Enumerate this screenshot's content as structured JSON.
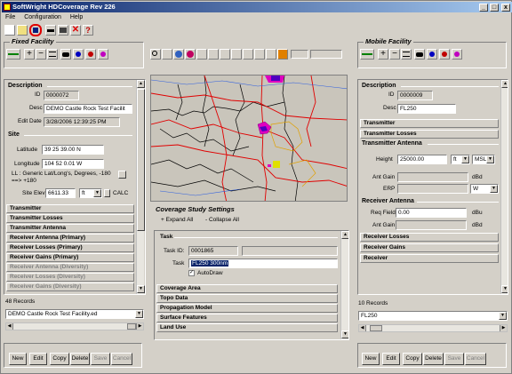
{
  "window": {
    "title": "SoftWright HDCoverage Rev 226",
    "min": "_",
    "max": "□",
    "close": "x"
  },
  "menu": [
    "File",
    "Configuration",
    "Help"
  ],
  "fixed": {
    "group_title": "Fixed Facility",
    "description": {
      "header": "Description",
      "id_label": "ID",
      "id": "0000072",
      "desc_label": "Desc",
      "desc": "DEMO Castle Rock Test Facilit",
      "edit_label": "Edit Date",
      "edit": "3/28/2006 12:39:25 PM"
    },
    "site": {
      "header": "Site",
      "lat_label": "Latitude",
      "lat": "39 25 39.00 N",
      "lon_label": "Longitude",
      "lon": "104 52 0.01 W",
      "ll_note": "LL : Generic Lat/Long's, Degrees, -180 ==> +180",
      "elev_label": "Site Elev",
      "elev": "6611.33",
      "unit": "ft",
      "calc": "CALC"
    },
    "sections": [
      "Transmitter",
      "Transmitter Losses",
      "Transmitter Antenna",
      "Receiver Antenna (Primary)",
      "Receiver Losses (Primary)",
      "Receiver Gains (Primary)",
      "Receiver Antenna (Diversity)",
      "Receiver Losses (Diversity)",
      "Receiver Gains (Diversity)"
    ],
    "records": "48 Records",
    "selected": "DEMO Castle Rock Test Facility.ed",
    "buttons": [
      "New",
      "Edit",
      "Copy",
      "Delete",
      "Save",
      "Cancel"
    ]
  },
  "mobile": {
    "group_title": "Mobile Facility",
    "description": {
      "header": "Description",
      "id_label": "ID",
      "id": "0000009",
      "desc_label": "Desc",
      "desc": "FL250"
    },
    "sections_top": [
      "Transmitter",
      "Transmitter Losses"
    ],
    "antenna": {
      "header": "Transmitter Antenna",
      "height_label": "Height",
      "height": "25000.00",
      "unit": "ft",
      "ref": "MSL",
      "gain_label": "Ant Gain",
      "gain_unit": "dBd",
      "erp_label": "ERP",
      "erp_unit": "W"
    },
    "rx": {
      "header": "Receiver Antenna",
      "req_label": "Req Field",
      "req": "0.00",
      "req_unit": "dBu",
      "gain_label": "Ant Gain",
      "gain_unit": "dBd"
    },
    "sections_bottom": [
      "Receiver Losses",
      "Receiver Gains",
      "Receiver"
    ],
    "records": "10 Records",
    "selected": "FL250",
    "buttons": [
      "New",
      "Edit",
      "Copy",
      "Delete",
      "Save",
      "Cancel"
    ]
  },
  "coverage": {
    "title": "Coverage Study Settings",
    "expand": "+ Expand All",
    "collapse": "- Collapse All",
    "task": {
      "header": "Task",
      "id_label": "Task ID:",
      "id": "0001865",
      "task_label": "Task",
      "task": "FL250 300nm",
      "autodraw": "AutoDraw"
    },
    "sections": [
      "Coverage Area",
      "Topo Data",
      "Propagation Model",
      "Surface Features",
      "Land Use"
    ]
  },
  "colors": {
    "accent": "#0a246a",
    "selection": "#0a246a",
    "map_bg": "#cbc7bd"
  }
}
